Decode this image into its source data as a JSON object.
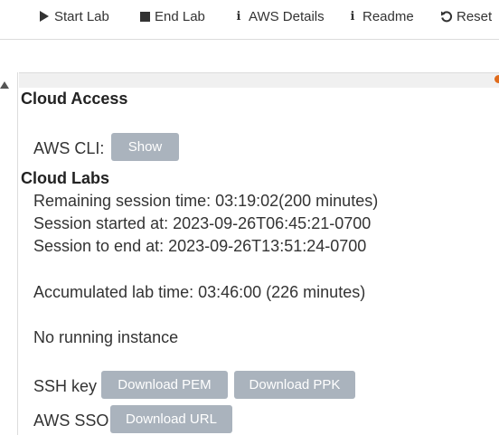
{
  "toolbar": {
    "start_lab": "Start Lab",
    "end_lab": "End Lab",
    "aws_details": "AWS Details",
    "readme": "Readme",
    "reset": "Reset"
  },
  "cloud_access": {
    "heading": "Cloud Access",
    "aws_cli_label": "AWS CLI:",
    "show_button": "Show"
  },
  "cloud_labs": {
    "heading": "Cloud Labs",
    "remaining": "Remaining session time: 03:19:02(200 minutes)",
    "started": "Session started at: 2023-09-26T06:45:21-0700",
    "to_end": "Session to end  at: 2023-09-26T13:51:24-0700",
    "accumulated": "Accumulated lab time: 03:46:00 (226 minutes)",
    "instance_status": "No running instance",
    "ssh_key_label": "SSH key",
    "download_pem": "Download PEM",
    "download_ppk": "Download PPK",
    "aws_sso_label": "AWS SSO",
    "download_url": "Download URL"
  },
  "colors": {
    "button_bg": "#aab3bd",
    "accent_dot": "#e06b1c"
  }
}
